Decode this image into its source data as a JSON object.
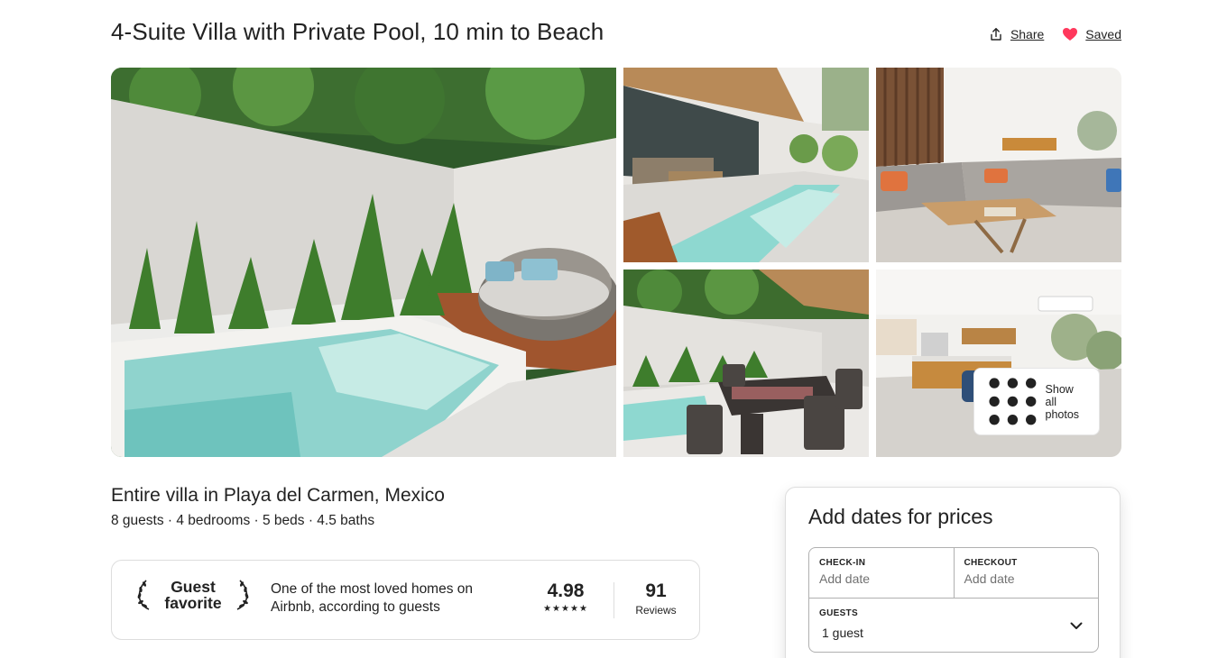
{
  "listing": {
    "title": "4-Suite Villa with Private Pool, 10 min to Beach",
    "share_label": "Share",
    "saved_label": "Saved",
    "icons": {
      "share": "share-icon",
      "saved": "heart-icon"
    },
    "colors": {
      "saved_heart": "#ff385c"
    }
  },
  "gallery": {
    "show_all_label": "Show all photos",
    "icon": "grid-dots-icon",
    "photos": [
      "pool-patio-photo",
      "pool-terrace-photo",
      "living-room-photo",
      "outdoor-dining-photo",
      "kitchen-dining-photo"
    ]
  },
  "details": {
    "heading": "Entire villa in Playa del Carmen, Mexico",
    "meta": "8 guests · 4 bedrooms · 5 beds · 4.5 baths"
  },
  "guest_favorite": {
    "badge_line1": "Guest",
    "badge_line2": "favorite",
    "description_line1": "One of the most loved homes on",
    "description_line2": "Airbnb, according to guests",
    "rating": "4.98",
    "stars": "★★★★★",
    "reviews_count": "91",
    "reviews_label": "Reviews"
  },
  "booking": {
    "title": "Add dates for prices",
    "checkin_label": "CHECK-IN",
    "checkin_placeholder": "Add date",
    "checkout_label": "CHECKOUT",
    "checkout_placeholder": "Add date",
    "guests_label": "GUESTS",
    "guests_value": "1 guest"
  }
}
